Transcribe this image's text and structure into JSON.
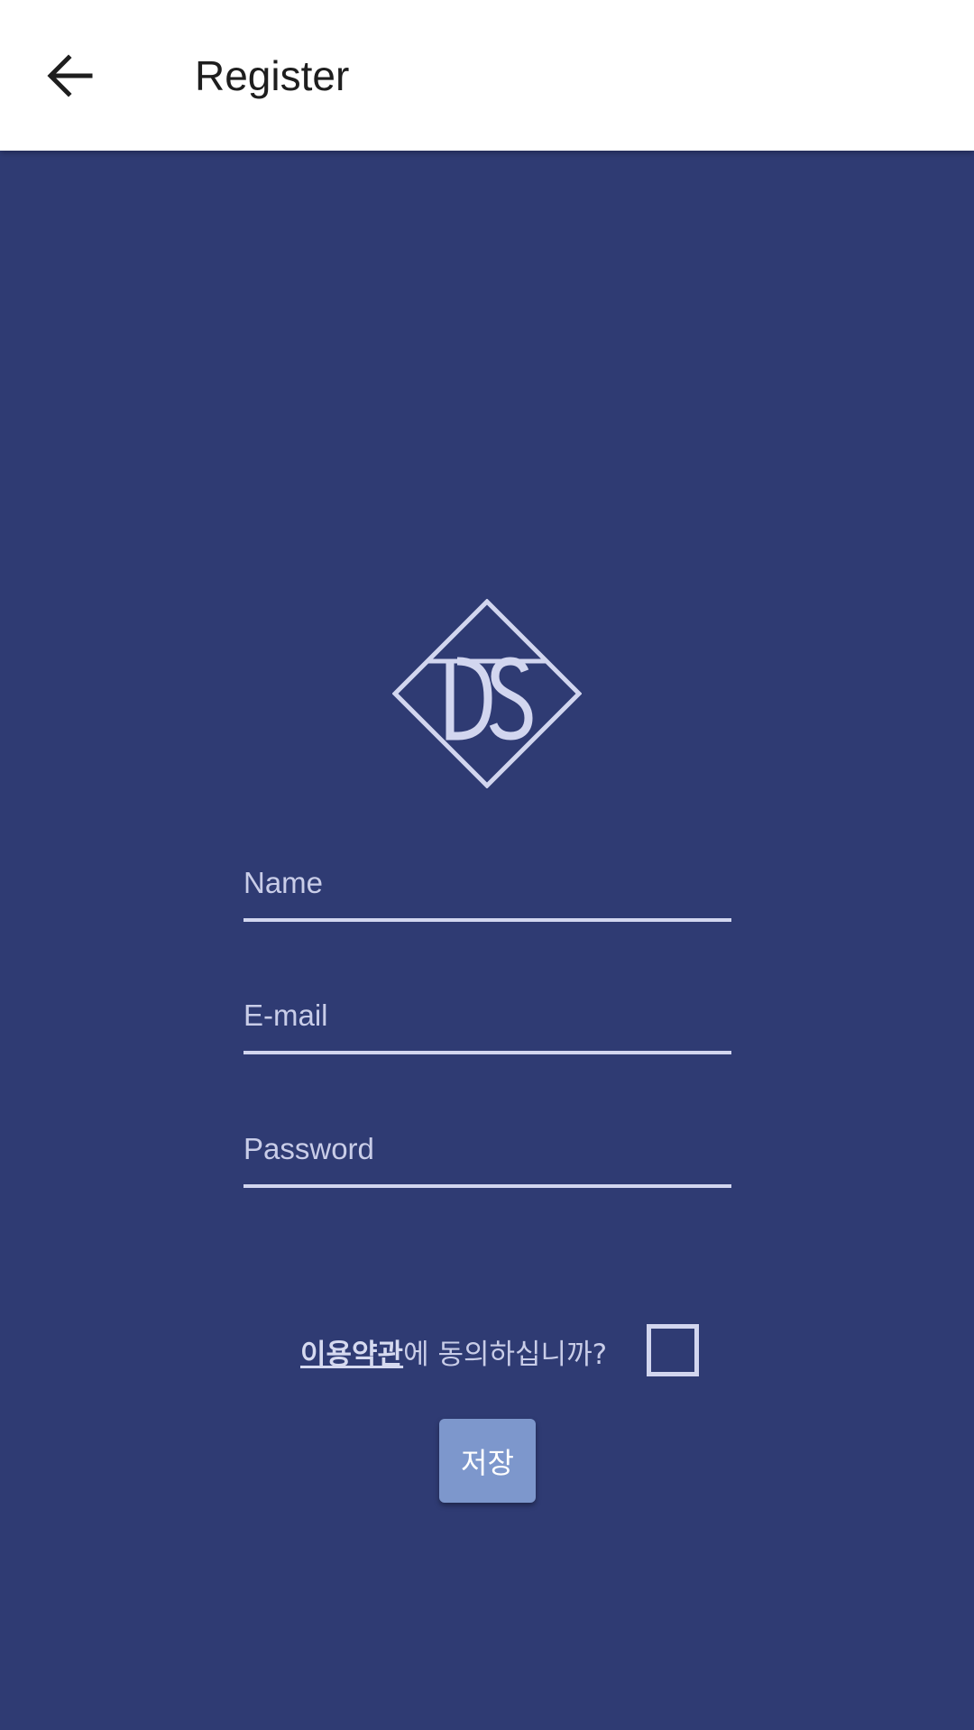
{
  "appbar": {
    "title": "Register",
    "back_icon": "arrow-left-icon"
  },
  "logo": {
    "text": "DS",
    "color": "#d2d6ef"
  },
  "form": {
    "name_placeholder": "Name",
    "email_placeholder": "E-mail",
    "password_placeholder": "Password"
  },
  "terms": {
    "link_label": "이용약관",
    "question": "에 동의하십니까?",
    "checked": false
  },
  "save_label": "저장",
  "colors": {
    "background": "#2f3b73",
    "appbar": "#ffffff",
    "accent": "#7d97cc",
    "line": "#d2d6ef"
  }
}
